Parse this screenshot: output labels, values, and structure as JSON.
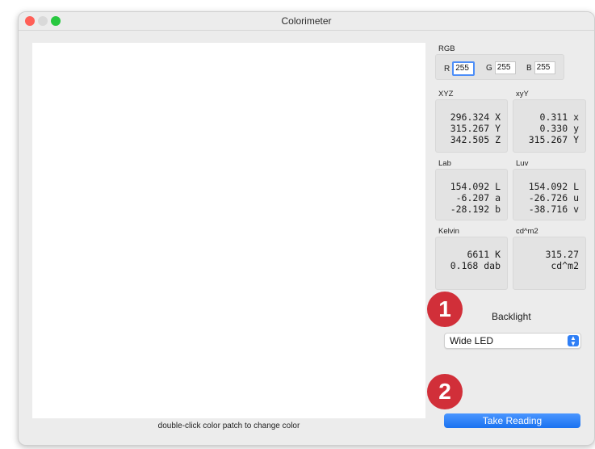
{
  "window": {
    "title": "Colorimeter"
  },
  "patch": {
    "caption": "double-click color patch to change color"
  },
  "rgb": {
    "label": "RGB",
    "r_letter": "R",
    "r_value": "255",
    "g_letter": "G",
    "g_value": "255",
    "b_letter": "B",
    "b_value": "255"
  },
  "xyz": {
    "label": "XYZ",
    "lines": [
      "296.324 X",
      "315.267 Y",
      "342.505 Z"
    ]
  },
  "xyY": {
    "label": "xyY",
    "lines": [
      "0.311 x",
      "0.330 y",
      "315.267 Y"
    ]
  },
  "lab": {
    "label": "Lab",
    "lines": [
      "154.092 L",
      "-6.207 a",
      "-28.192 b"
    ]
  },
  "luv": {
    "label": "Luv",
    "lines": [
      "154.092 L",
      "-26.726 u",
      "-38.716 v"
    ]
  },
  "kelvin": {
    "label": "Kelvin",
    "lines": [
      "6611 K",
      "0.168 dab"
    ]
  },
  "cdm2": {
    "label": "cd^m2",
    "lines": [
      "315.27",
      "cd^m2"
    ]
  },
  "badges": {
    "one": "1",
    "two": "2"
  },
  "backlight": {
    "label": "Backlight",
    "selected": "Wide LED"
  },
  "actions": {
    "take_reading": "Take Reading"
  },
  "colors": {
    "accent": "#2f7ff6",
    "badge": "#d12f39"
  }
}
